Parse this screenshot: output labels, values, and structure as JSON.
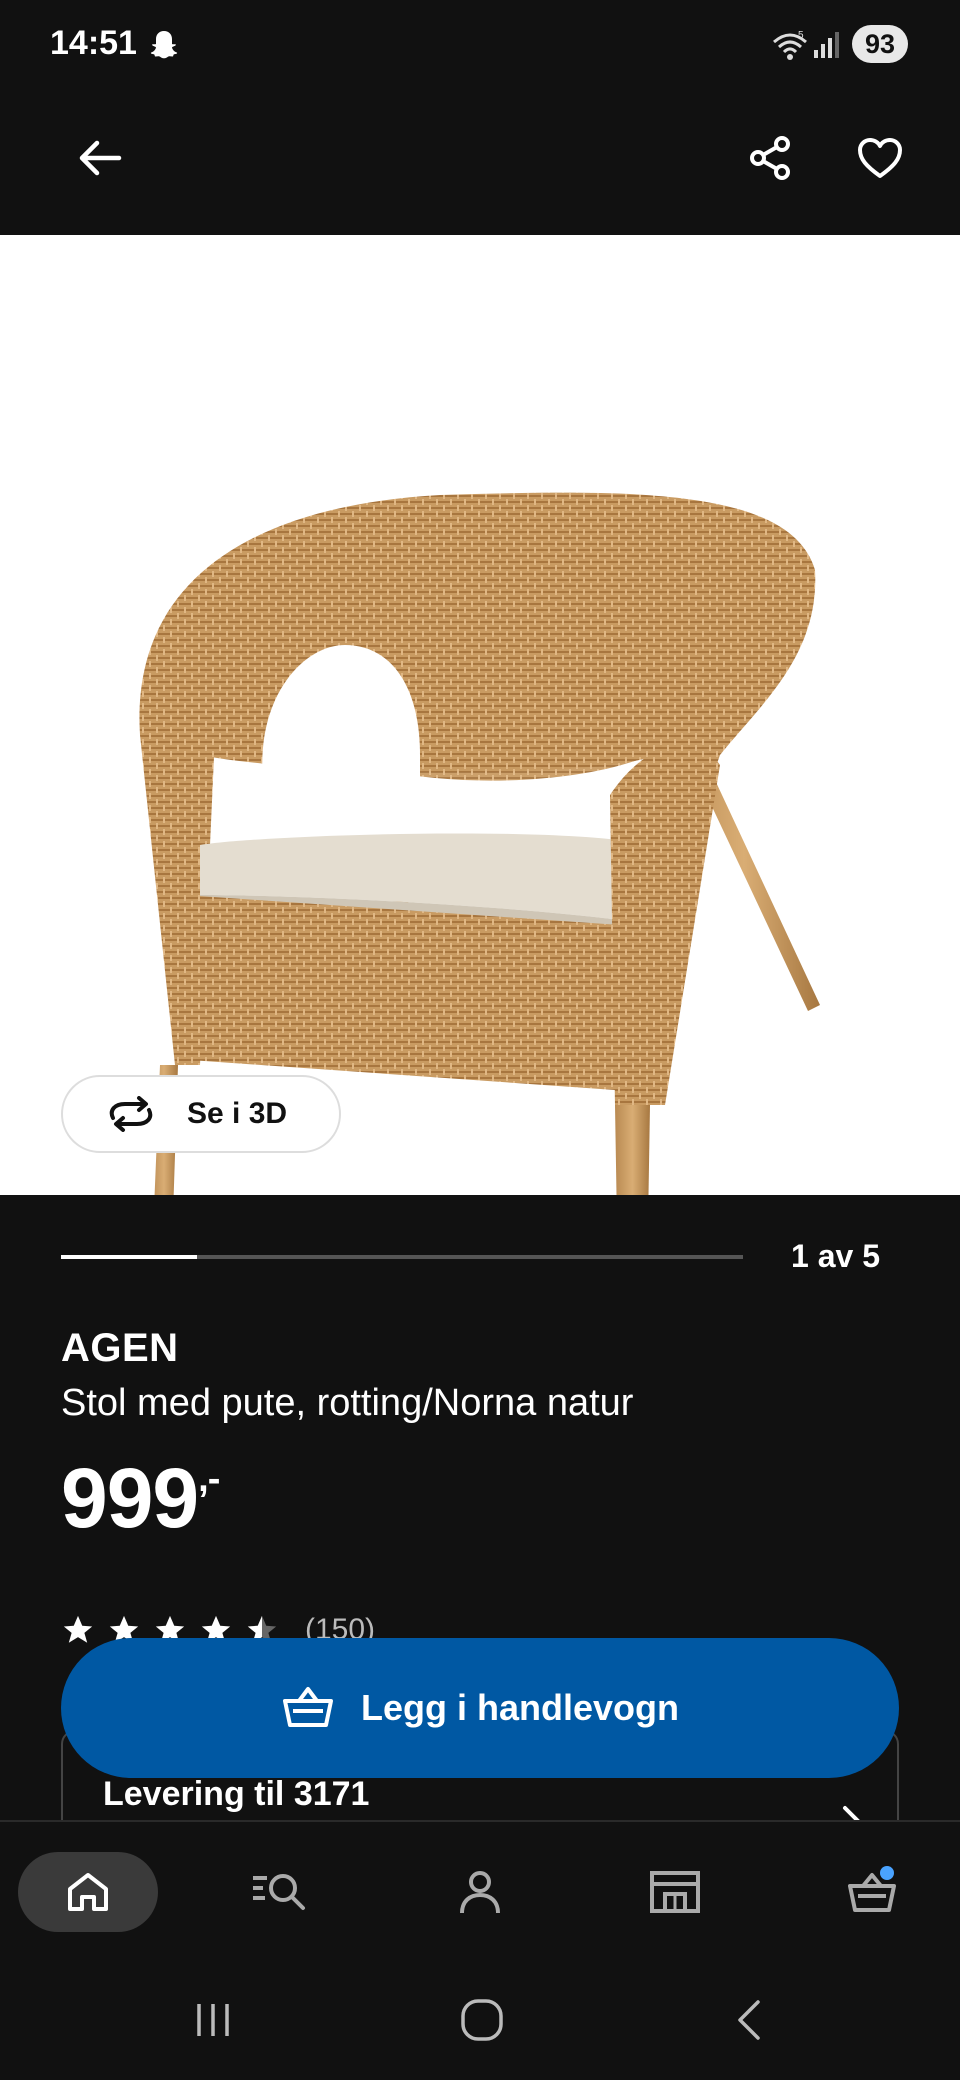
{
  "status_bar": {
    "time": "14:51",
    "battery": "93",
    "icons": [
      "snapchat-icon",
      "wifi-icon",
      "signal-icon"
    ]
  },
  "top_bar": {
    "icons": [
      "back-arrow-icon",
      "share-icon",
      "heart-icon"
    ]
  },
  "product_image": {
    "view_3d_label": "Se i 3D",
    "view_3d_icon": "rotate-3d-icon"
  },
  "carousel": {
    "counter": "1 av 5",
    "current": 1,
    "total": 5
  },
  "product": {
    "name": "AGEN",
    "description": "Stol med pute, rotting/Norna natur",
    "price": "999",
    "price_suffix": ",-",
    "rating": 4.5,
    "rating_count": "(150)"
  },
  "delivery": {
    "label": "Levering til 3171"
  },
  "add_to_cart": {
    "label": "Legg i handlevogn",
    "icon": "basket-icon",
    "color": "#0058a3"
  },
  "bottom_nav": {
    "items": [
      "home-icon",
      "search-icon",
      "profile-icon",
      "store-icon",
      "cart-icon"
    ],
    "active": "home-icon",
    "badge_color": "#4aa3ff"
  },
  "system_nav": {
    "items": [
      "recents-icon",
      "home-circle-icon",
      "back-icon"
    ]
  }
}
